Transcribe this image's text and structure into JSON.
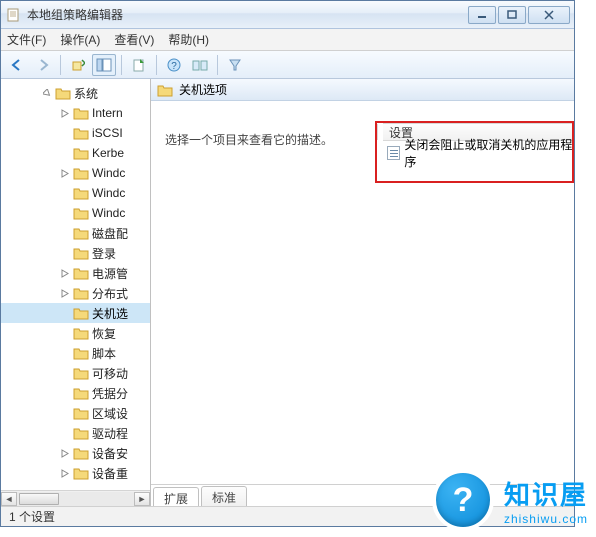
{
  "window": {
    "title": "本地组策略编辑器"
  },
  "menu": {
    "file": "文件(F)",
    "action": "操作(A)",
    "view": "查看(V)",
    "help": "帮助(H)"
  },
  "tree": {
    "root": "系统",
    "items": [
      {
        "label": "Intern",
        "expandable": true
      },
      {
        "label": "iSCSI",
        "expandable": false
      },
      {
        "label": "Kerbe",
        "expandable": false
      },
      {
        "label": "Windc",
        "expandable": true
      },
      {
        "label": "Windc",
        "expandable": false
      },
      {
        "label": "Windc",
        "expandable": false
      },
      {
        "label": "磁盘配",
        "expandable": false
      },
      {
        "label": "登录",
        "expandable": false
      },
      {
        "label": "电源管",
        "expandable": true
      },
      {
        "label": "分布式",
        "expandable": true
      },
      {
        "label": "关机选",
        "expandable": false,
        "selected": true
      },
      {
        "label": "恢复",
        "expandable": false
      },
      {
        "label": "脚本",
        "expandable": false
      },
      {
        "label": "可移动",
        "expandable": false
      },
      {
        "label": "凭据分",
        "expandable": false
      },
      {
        "label": "区域设",
        "expandable": false
      },
      {
        "label": "驱动程",
        "expandable": false
      },
      {
        "label": "设备安",
        "expandable": true
      },
      {
        "label": "设备重",
        "expandable": true
      }
    ]
  },
  "right": {
    "header": "关机选项",
    "desc": "选择一个项目来查看它的描述。",
    "col": "设置",
    "setting": "关闭会阻止或取消关机的应用程序"
  },
  "tabs": {
    "ext": "扩展",
    "std": "标准"
  },
  "status": "1 个设置",
  "watermark": {
    "cn": "知识屋",
    "en": "zhishiwu.com",
    "icon": "?"
  }
}
